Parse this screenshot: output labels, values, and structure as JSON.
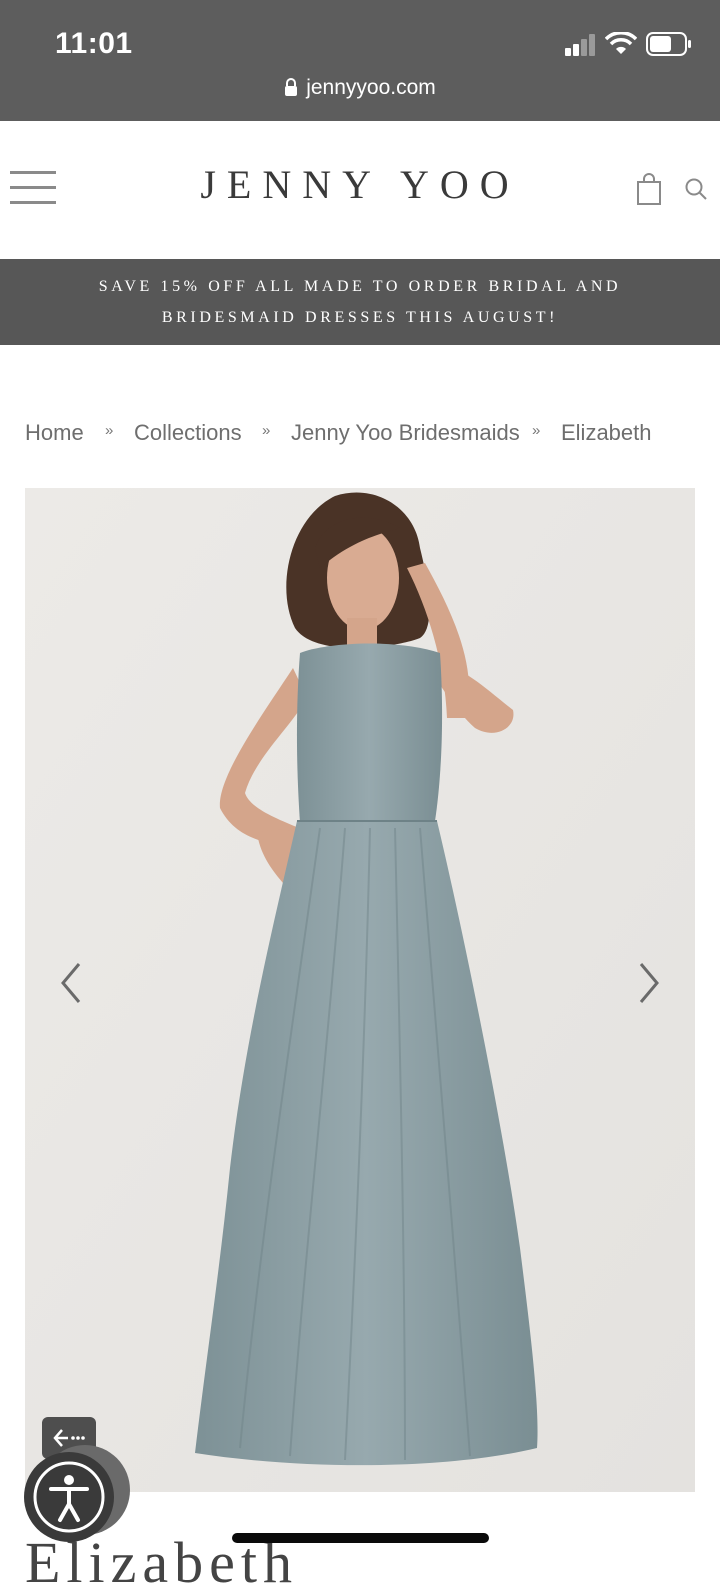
{
  "status_bar": {
    "time": "11:01"
  },
  "browser": {
    "url": "jennyyoo.com"
  },
  "header": {
    "brand": "JENNY YOO"
  },
  "promo": {
    "line1": "SAVE 15% OFF ALL MADE TO ORDER BRIDAL AND",
    "line2": "BRIDESMAID DRESSES THIS AUGUST!"
  },
  "breadcrumb": {
    "items": [
      "Home",
      "Collections",
      "Jenny Yoo Bridesmaids",
      "Elizabeth"
    ],
    "separator": "»"
  },
  "product": {
    "title_partial": "Elizabeth"
  },
  "colors": {
    "status_bar_bg": "#5d5d5d",
    "promo_bg": "#575757",
    "dress": "#8c9ea3",
    "image_bg": "#ebe9e6"
  },
  "icons": [
    "lock-icon",
    "hamburger-menu-icon",
    "shopping-bag-icon",
    "search-icon",
    "chevron-left-icon",
    "chevron-right-icon",
    "back-arrow-icon",
    "accessibility-icon"
  ]
}
